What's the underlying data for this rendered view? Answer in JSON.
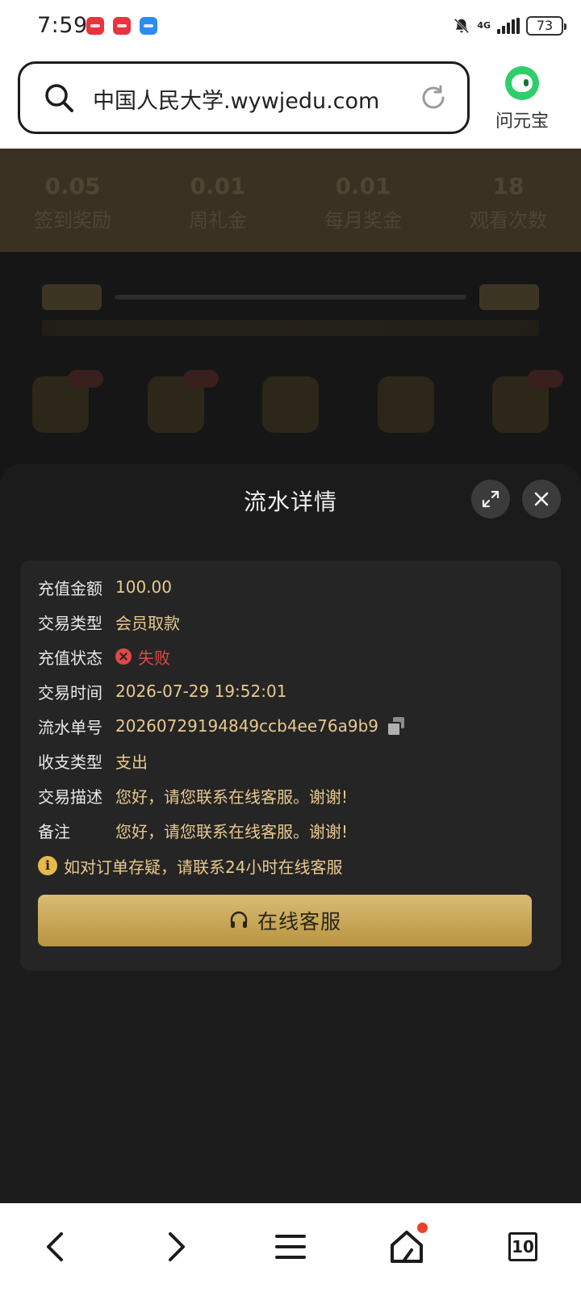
{
  "status_bar": {
    "time": "7:59",
    "network": "4G",
    "battery": "73"
  },
  "browser": {
    "url": "中国人民大学.wywjedu.com",
    "assistant_label": "问元宝"
  },
  "background": {
    "stats": [
      {
        "value": "0.05",
        "label": "签到奖励"
      },
      {
        "value": "0.01",
        "label": "周礼金"
      },
      {
        "value": "0.01",
        "label": "每月奖金"
      },
      {
        "value": "18",
        "label": "观看次数"
      }
    ]
  },
  "sheet": {
    "title": "流水详情",
    "fields": [
      {
        "label": "充值金额",
        "value": "100.00"
      },
      {
        "label": "交易类型",
        "value": "会员取款"
      },
      {
        "label": "充值状态",
        "value": "失败"
      },
      {
        "label": "交易时间",
        "value": "2026-07-29 19:52:01"
      },
      {
        "label": "流水单号",
        "value": "20260729194849ccb4ee76a9b9"
      },
      {
        "label": "收支类型",
        "value": "支出"
      },
      {
        "label": "交易描述",
        "value": "您好，请您联系在线客服。谢谢!"
      },
      {
        "label": "备注",
        "value": "您好，请您联系在线客服。谢谢!"
      }
    ],
    "notice": "如对订单存疑，请联系24小时在线客服",
    "cs_button": "在线客服"
  },
  "bottom_nav": {
    "tab_count": "10"
  },
  "colors": {
    "accent_gold": "#e8c98f",
    "fail_red": "#e04848",
    "button_gold": "#c9a95a"
  }
}
